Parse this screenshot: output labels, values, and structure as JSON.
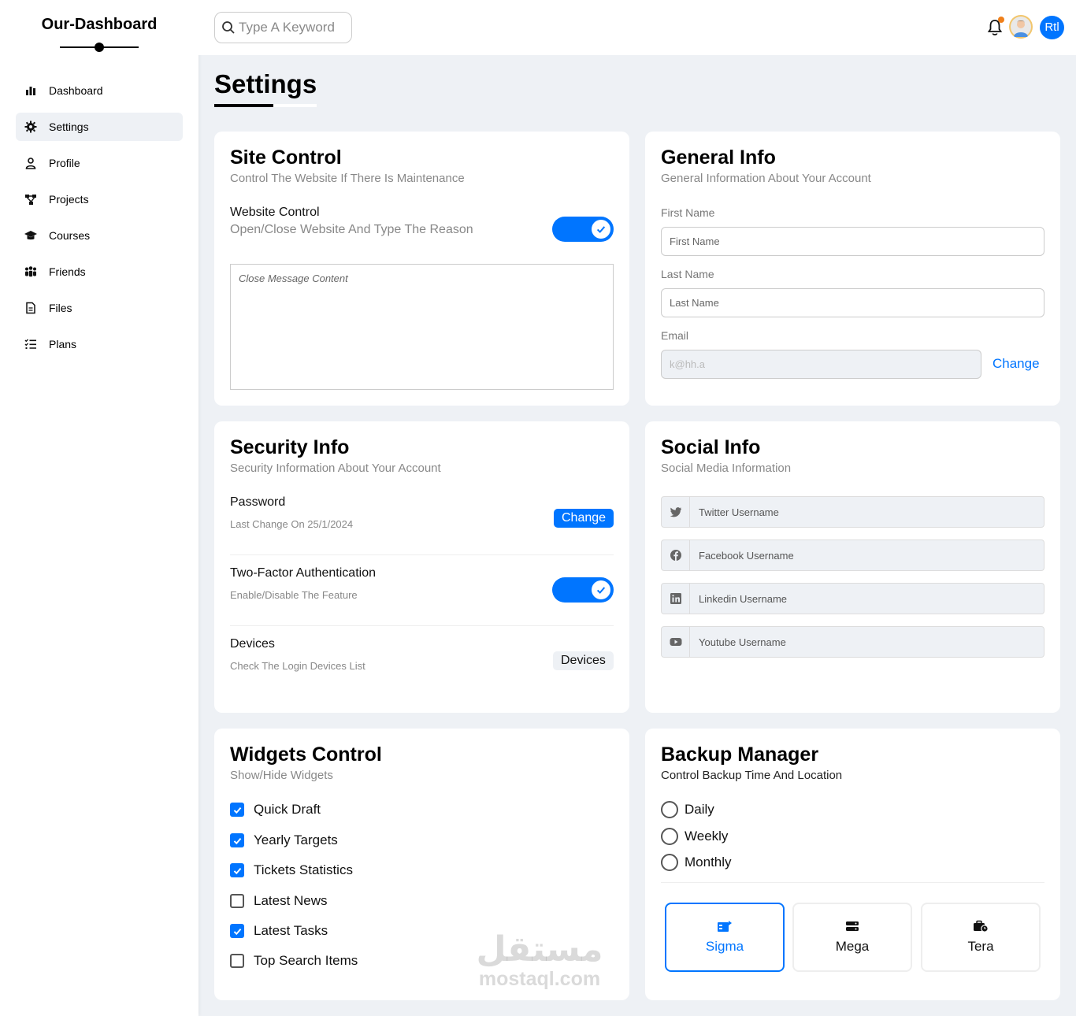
{
  "brand": {
    "title": "Our-Dashboard"
  },
  "sidebar": {
    "items": [
      {
        "label": "Dashboard",
        "icon": "chart-simple-icon"
      },
      {
        "label": "Settings",
        "icon": "gear-icon",
        "active": true
      },
      {
        "label": "Profile",
        "icon": "user-icon"
      },
      {
        "label": "Projects",
        "icon": "diagram-project-icon"
      },
      {
        "label": "Courses",
        "icon": "graduation-cap-icon"
      },
      {
        "label": "Friends",
        "icon": "users-icon"
      },
      {
        "label": "Files",
        "icon": "file-icon"
      },
      {
        "label": "Plans",
        "icon": "list-check-icon"
      }
    ]
  },
  "header": {
    "search_placeholder": "Type A Keyword",
    "rtl_label": "Rtl",
    "notification_dot_color": "#ef7f1a"
  },
  "page": {
    "title": "Settings"
  },
  "site_control": {
    "title": "Site Control",
    "subtitle": "Control The Website If There Is Maintenance",
    "row_label": "Website Control",
    "row_desc": "Open/Close Website And Type The Reason",
    "toggle_on": true,
    "textarea_placeholder": "Close Message Content"
  },
  "general_info": {
    "title": "General Info",
    "subtitle": "General Information About Your Account",
    "first_name_label": "First Name",
    "first_name_placeholder": "First Name",
    "last_name_label": "Last Name",
    "last_name_placeholder": "Last Name",
    "email_label": "Email",
    "email_value": "k@hh.a",
    "change_label": "Change"
  },
  "security_info": {
    "title": "Security Info",
    "subtitle": "Security Information About Your Account",
    "password_label": "Password",
    "password_desc": "Last Change On 25/1/2024",
    "password_button": "Change",
    "twofa_label": "Two-Factor Authentication",
    "twofa_desc": "Enable/Disable The Feature",
    "twofa_on": true,
    "devices_label": "Devices",
    "devices_desc": "Check The Login Devices List",
    "devices_button": "Devices"
  },
  "social_info": {
    "title": "Social Info",
    "subtitle": "Social Media Information",
    "fields": [
      {
        "icon": "twitter-icon",
        "placeholder": "Twitter Username"
      },
      {
        "icon": "facebook-icon",
        "placeholder": "Facebook Username"
      },
      {
        "icon": "linkedin-icon",
        "placeholder": "Linkedin Username"
      },
      {
        "icon": "youtube-icon",
        "placeholder": "Youtube Username"
      }
    ]
  },
  "widgets_control": {
    "title": "Widgets Control",
    "subtitle": "Show/Hide Widgets",
    "items": [
      {
        "label": "Quick Draft",
        "checked": true
      },
      {
        "label": "Yearly Targets",
        "checked": true
      },
      {
        "label": "Tickets Statistics",
        "checked": true
      },
      {
        "label": "Latest News",
        "checked": false
      },
      {
        "label": "Latest Tasks",
        "checked": true
      },
      {
        "label": "Top Search Items",
        "checked": false
      }
    ]
  },
  "backup_manager": {
    "title": "Backup Manager",
    "subtitle": "Control Backup Time And Location",
    "options": [
      "Daily",
      "Weekly",
      "Monthly"
    ],
    "servers": [
      {
        "name": "Sigma",
        "icon": "server-icon",
        "active": true
      },
      {
        "name": "Mega",
        "icon": "database-icon",
        "active": false
      },
      {
        "name": "Tera",
        "icon": "briefcase-clock-icon",
        "active": false
      }
    ]
  },
  "watermark": {
    "arabic": "مستقل",
    "latin": "mostaql.com"
  },
  "colors": {
    "accent": "#0075ff",
    "background": "#eef1f5"
  }
}
